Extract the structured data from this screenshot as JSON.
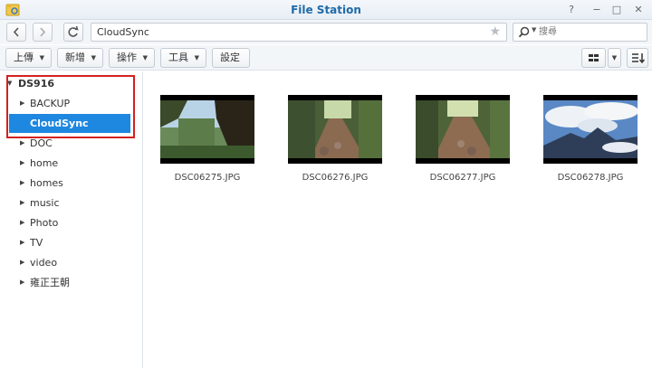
{
  "window": {
    "title": "File Station",
    "help": "?",
    "minimize": "−",
    "maximize": "□",
    "close": "✕"
  },
  "nav": {
    "path": "CloudSync",
    "search_placeholder": "搜尋"
  },
  "toolbar": {
    "upload": "上傳",
    "new": "新增",
    "action": "操作",
    "tools": "工具",
    "settings": "設定"
  },
  "sidebar": {
    "root": "DS916",
    "items": [
      {
        "label": "BACKUP",
        "selected": false
      },
      {
        "label": "CloudSync",
        "selected": true
      },
      {
        "label": "DOC",
        "selected": false
      },
      {
        "label": "home",
        "selected": false
      },
      {
        "label": "homes",
        "selected": false
      },
      {
        "label": "music",
        "selected": false
      },
      {
        "label": "Photo",
        "selected": false
      },
      {
        "label": "TV",
        "selected": false
      },
      {
        "label": "video",
        "selected": false
      },
      {
        "label": "雍正王朝",
        "selected": false
      }
    ]
  },
  "files": [
    {
      "name": "DSC06275.JPG"
    },
    {
      "name": "DSC06276.JPG"
    },
    {
      "name": "DSC06277.JPG"
    },
    {
      "name": "DSC06278.JPG"
    }
  ],
  "colors": {
    "accent": "#1e87e0",
    "title": "#1f6aa8",
    "highlight": "#d42020"
  }
}
